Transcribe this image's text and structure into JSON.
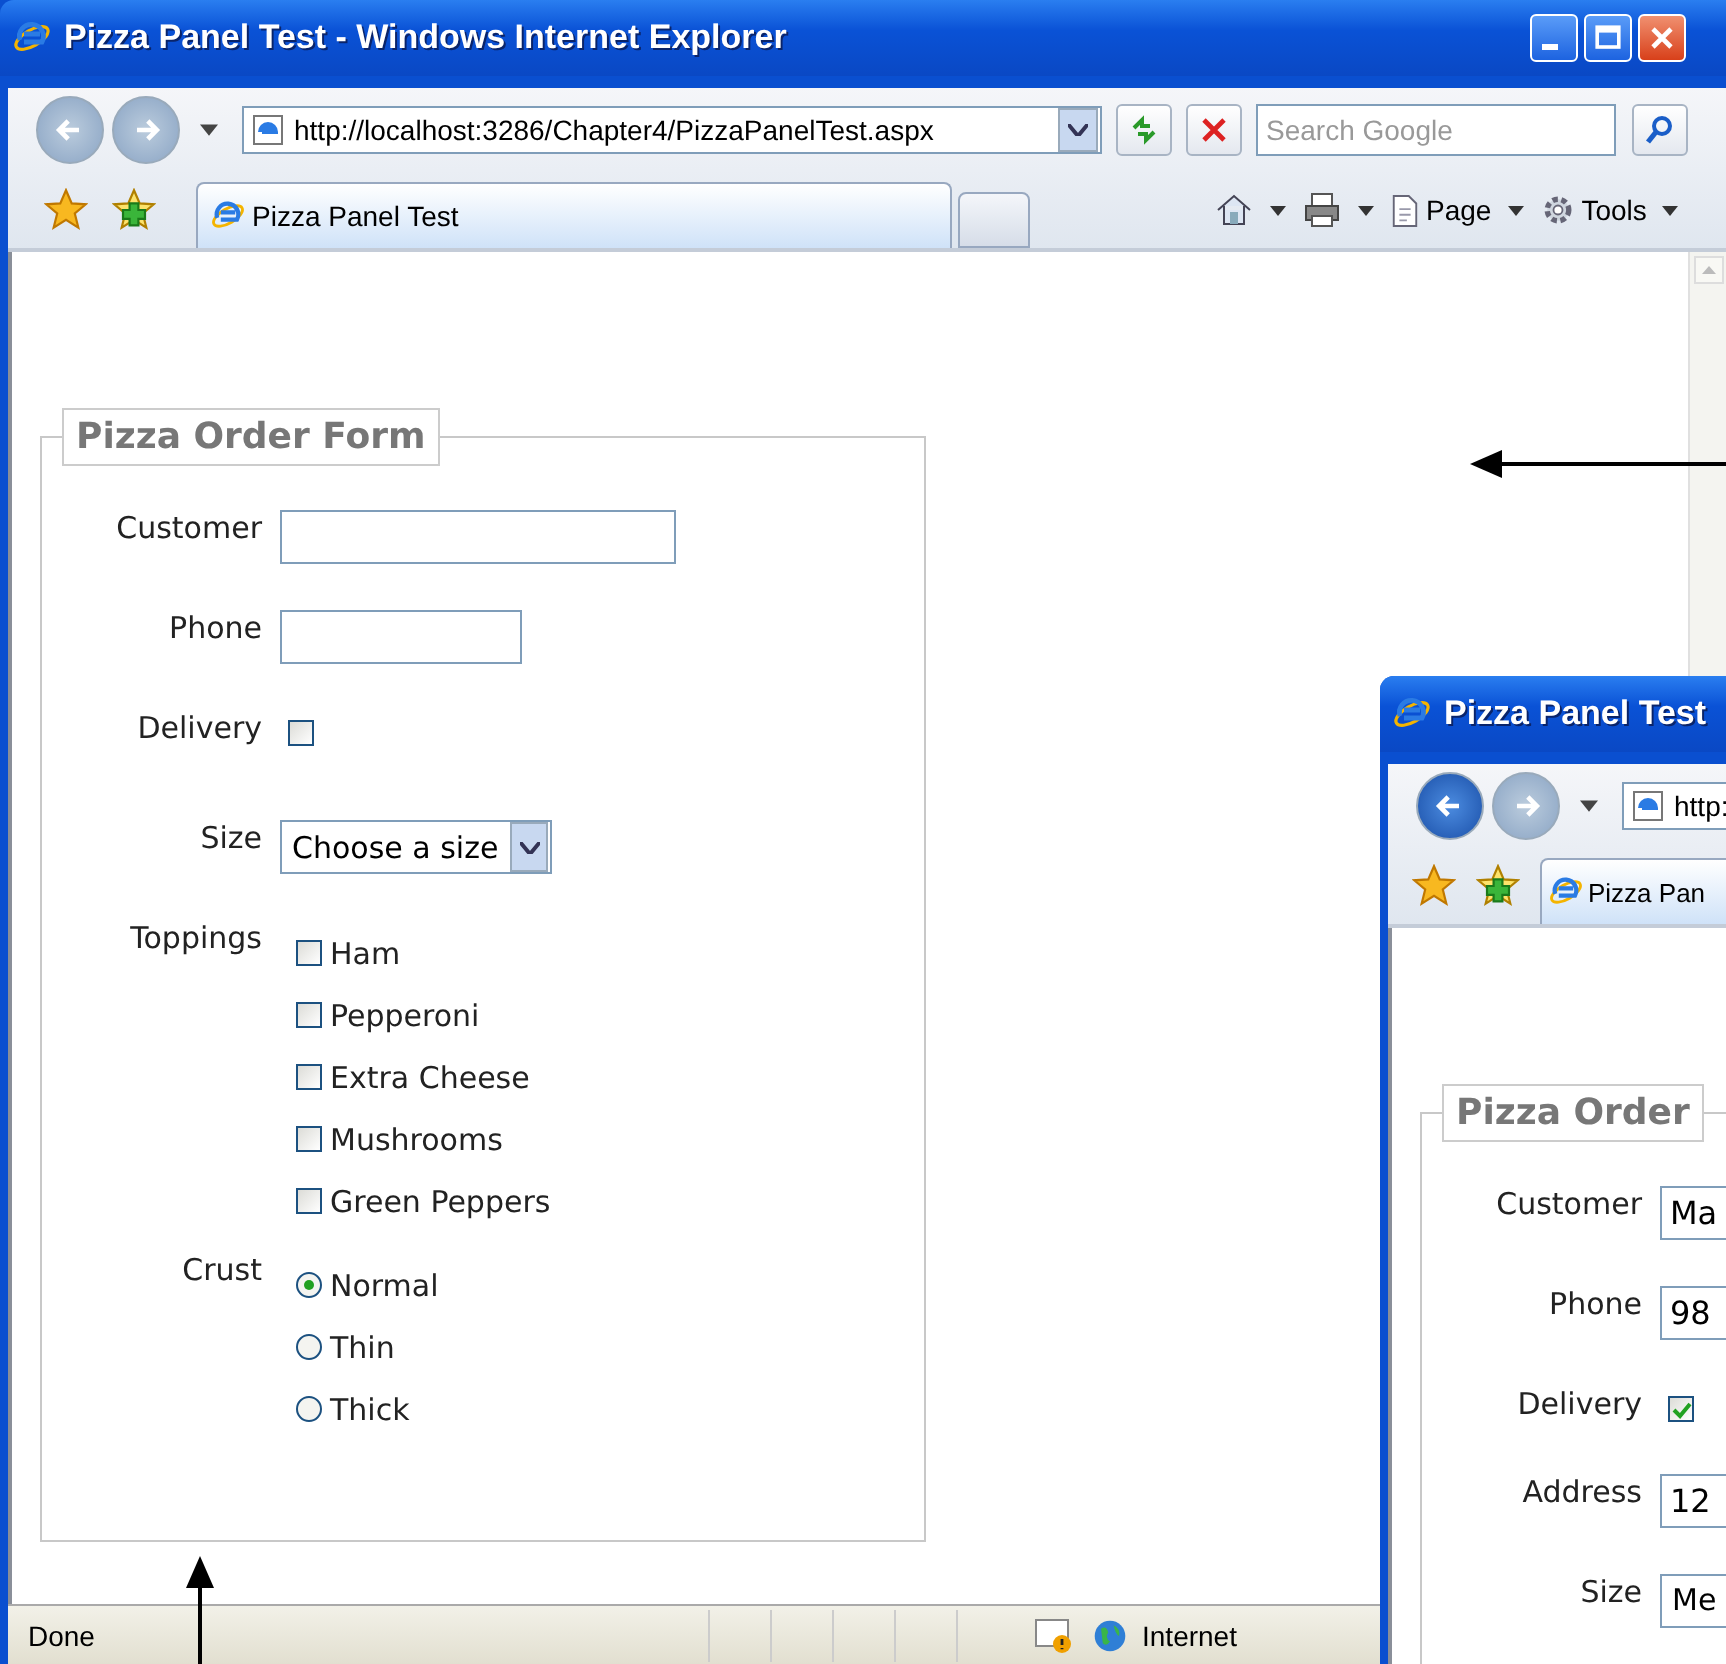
{
  "windows": [
    {
      "title": "Pizza Panel Test - Windows Internet Explorer",
      "address": "http://localhost:3286/Chapter4/PizzaPanelTest.aspx",
      "search_placeholder": "Search Google",
      "tab": "Pizza Panel Test",
      "toolbar": [
        {
          "label": "Page"
        },
        {
          "label": "Tools"
        }
      ],
      "status": "Done",
      "zone": "Internet",
      "form": {
        "legend": "Pizza Order Form",
        "fields": [
          {
            "kind": "text",
            "label": "Customer"
          },
          {
            "kind": "short-text",
            "label": "Phone"
          },
          {
            "kind": "checkbox",
            "label": "Delivery",
            "checked": false
          },
          {
            "kind": "select",
            "label": "Size",
            "value": "Choose a size"
          },
          {
            "kind": "checklist",
            "label": "Toppings",
            "options": [
              {
                "label": "Ham",
                "checked": false
              },
              {
                "label": "Pepperoni",
                "checked": false
              },
              {
                "label": "Extra Cheese",
                "checked": false
              },
              {
                "label": "Mushrooms",
                "checked": false
              },
              {
                "label": "Green Peppers",
                "checked": false
              }
            ]
          },
          {
            "kind": "radios",
            "label": "Crust",
            "options": [
              {
                "label": "Normal",
                "selected": true
              },
              {
                "label": "Thin",
                "selected": false
              },
              {
                "label": "Thick",
                "selected": false
              }
            ]
          }
        ]
      }
    },
    {
      "title": "Pizza Panel Test",
      "address": "http:",
      "tab": "Pizza Pan",
      "form": {
        "legend": "Pizza Order",
        "fields": [
          {
            "kind": "text",
            "label": "Customer",
            "value": "Ma"
          },
          {
            "kind": "text",
            "label": "Phone",
            "value": "98"
          },
          {
            "kind": "checkbox",
            "label": "Delivery",
            "checked": true
          },
          {
            "kind": "text",
            "label": "Address",
            "value": "12"
          },
          {
            "kind": "select",
            "label": "Size",
            "value": "Me"
          }
        ]
      }
    }
  ]
}
